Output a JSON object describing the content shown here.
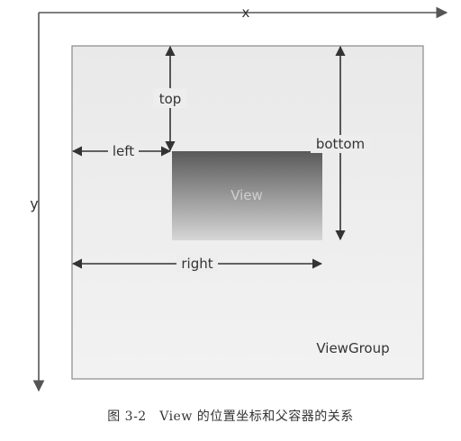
{
  "axes": {
    "x_label": "x",
    "y_label": "y"
  },
  "dimensions": {
    "top": "top",
    "left": "left",
    "bottom": "bottom",
    "right": "right"
  },
  "boxes": {
    "view": "View",
    "view_group": "ViewGroup"
  },
  "caption": "图 3-2　View 的位置坐标和父容器的关系",
  "colors": {
    "axis": "#555555",
    "view_group_fill": "#eeeeee",
    "view_group_border": "#8a8a8a",
    "view_gradient_top": "#5a5a5a",
    "view_gradient_bottom": "#d6d6d6",
    "arrow": "#333333"
  }
}
